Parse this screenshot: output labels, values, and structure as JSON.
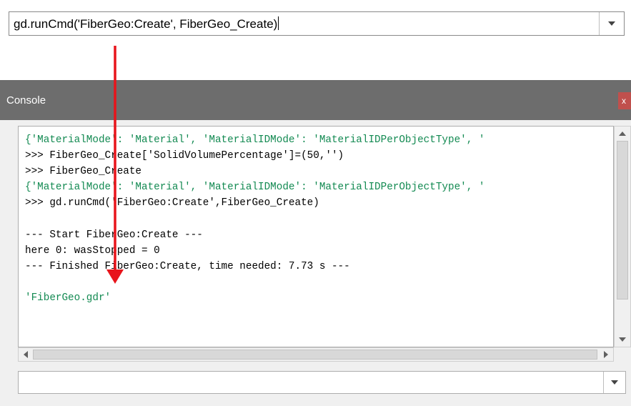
{
  "command_bar": {
    "value": "gd.runCmd('FiberGeo:Create', FiberGeo_Create)",
    "dropdown_icon": "chevron-down-icon"
  },
  "console": {
    "title": "Console",
    "close_label": "x",
    "output": [
      {
        "text": "{'MaterialMode': 'Material', 'MaterialIDMode': 'MaterialIDPerObjectType', '",
        "kind": "result"
      },
      {
        "text": ">>> FiberGeo_Create['SolidVolumePercentage']=(50,'')",
        "kind": "input"
      },
      {
        "text": ">>> FiberGeo_Create",
        "kind": "input"
      },
      {
        "text": "{'MaterialMode': 'Material', 'MaterialIDMode': 'MaterialIDPerObjectType', '",
        "kind": "result"
      },
      {
        "text": ">>> gd.runCmd('FiberGeo:Create',FiberGeo_Create)",
        "kind": "input"
      },
      {
        "text": "",
        "kind": "blank"
      },
      {
        "text": "--- Start FiberGeo:Create ---",
        "kind": "log"
      },
      {
        "text": "here 0: wasStopped = 0",
        "kind": "log"
      },
      {
        "text": "--- Finished FiberGeo:Create, time needed: 7.73 s ---",
        "kind": "log"
      },
      {
        "text": "",
        "kind": "blank"
      },
      {
        "text": "'FiberGeo.gdr'",
        "kind": "result"
      }
    ],
    "input_value": "",
    "colors": {
      "titlebar": "#6d6d6d",
      "close": "#c0504d",
      "result_text": "#138a52",
      "annotation_arrow": "#e8141b"
    }
  }
}
